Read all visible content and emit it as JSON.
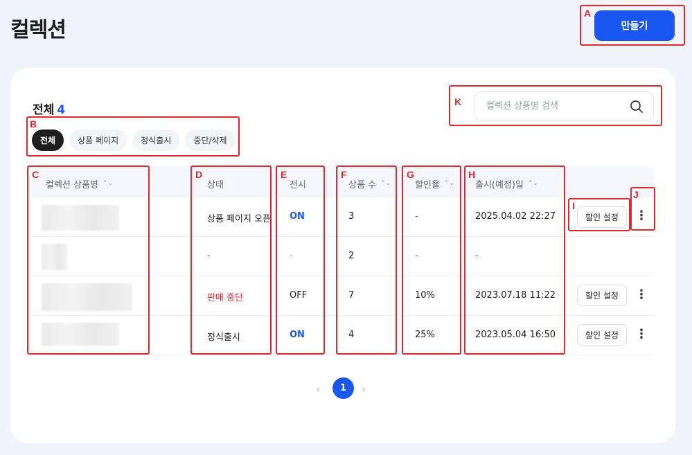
{
  "page": {
    "title": "컬렉션",
    "create_label": "만들기"
  },
  "summary": {
    "total_label": "전체",
    "total_count": "4"
  },
  "search": {
    "placeholder": "컬렉션 상품명 검색"
  },
  "filters": [
    "전체",
    "상품 페이지",
    "정식출시",
    "중단/삭제"
  ],
  "columns": [
    "컬렉션 상품명",
    "상태",
    "전시",
    "상품 수",
    "할인율",
    "출시(예정)일"
  ],
  "rows": [
    {
      "status": "상품 페이지 오픈",
      "display": "ON",
      "count": "3",
      "discount": "-",
      "date": "2025.04.02 22:27",
      "action": "할인 설정"
    },
    {
      "status": "-",
      "display": "-",
      "count": "2",
      "discount": "-",
      "date": "-",
      "action": ""
    },
    {
      "status": "판매 중단",
      "display": "OFF",
      "count": "7",
      "discount": "10%",
      "date": "2023.07.18 11:22",
      "action": "할인 설정"
    },
    {
      "status": "정식출시",
      "display": "ON",
      "count": "4",
      "discount": "25%",
      "date": "2023.05.04 16:50",
      "action": "할인 설정"
    }
  ],
  "pagination": {
    "prev": "‹",
    "current": "1",
    "next": "›"
  },
  "annotations": [
    "A",
    "B",
    "C",
    "D",
    "E",
    "F",
    "G",
    "H",
    "I",
    "J",
    "K"
  ],
  "colors": {
    "accent": "#1a56f0",
    "annotation": "#e0282e",
    "danger": "#e0282e"
  },
  "icons": {
    "search": "search-icon",
    "sort": "sort-icon",
    "more": "more-vertical-icon"
  }
}
